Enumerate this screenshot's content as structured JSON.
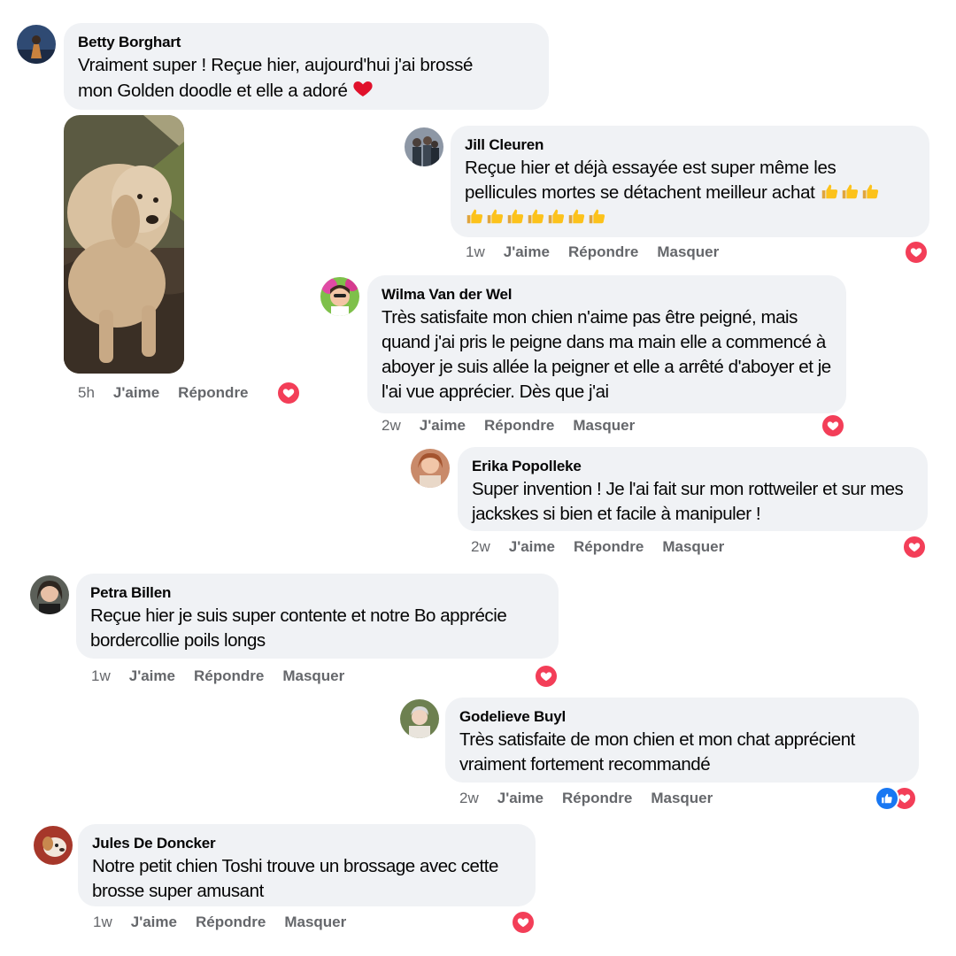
{
  "comments": [
    {
      "name": "Betty Borghart",
      "text_line1": "Vraiment super ! Reçue hier, aujourd'hui j'ai brossé",
      "text_line2": "mon Golden doodle et elle a adoré",
      "emoji": "heart",
      "time": "5h",
      "like": "J'aime",
      "reply": "Répondre",
      "photo": "golden-doodle-dog-photo",
      "reactions": [
        "love"
      ]
    },
    {
      "name": "Jill Cleuren",
      "text_line1": "Reçue hier et déjà essayée est super même les",
      "text_line2": "pellicules mortes se détachent meilleur achat",
      "emoji": "thumbs-up",
      "time": "1w",
      "like": "J'aime",
      "reply": "Répondre",
      "hide": "Masquer",
      "reactions": [
        "love"
      ]
    },
    {
      "name": "Wilma Van der Wel",
      "text": "Très satisfaite mon chien n'aime pas être peigné, mais quand j'ai pris le peigne dans ma main elle a commencé à aboyer je suis allée la peigner et elle a arrêté d'aboyer et je l'ai vue apprécier. Dès que j'ai",
      "time": "2w",
      "like": "J'aime",
      "reply": "Répondre",
      "hide": "Masquer",
      "reactions": [
        "love"
      ]
    },
    {
      "name": "Erika Popolleke",
      "text": "Super invention ! Je l'ai fait sur mon rottweiler et sur mes jackskes si bien et facile à manipuler !",
      "time": "2w",
      "like": "J'aime",
      "reply": "Répondre",
      "hide": "Masquer",
      "reactions": [
        "love"
      ]
    },
    {
      "name": "Petra Billen",
      "text": "Reçue hier je suis super contente et notre Bo apprécie bordercollie poils longs",
      "time": "1w",
      "like": "J'aime",
      "reply": "Répondre",
      "hide": "Masquer",
      "reactions": [
        "love"
      ]
    },
    {
      "name": "Godelieve Buyl",
      "text": "Très satisfaite de mon chien et mon chat apprécient vraiment fortement recommandé",
      "time": "2w",
      "like": "J'aime",
      "reply": "Répondre",
      "hide": "Masquer",
      "reactions": [
        "like",
        "love"
      ]
    },
    {
      "name": "Jules De Doncker",
      "text": "Notre petit chien Toshi trouve un brossage avec cette brosse super amusant",
      "time": "1w",
      "like": "J'aime",
      "reply": "Répondre",
      "hide": "Masquer",
      "reactions": [
        "love"
      ]
    }
  ],
  "colors": {
    "bubble": "#f0f2f5",
    "meta": "#65676b",
    "love": "#f33e58",
    "like": "#1877f2"
  }
}
